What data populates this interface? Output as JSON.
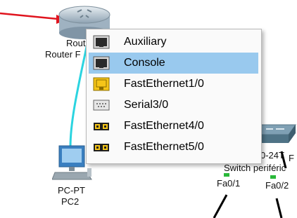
{
  "topology": {
    "router": {
      "label_line1": "Rout",
      "label_line2": "Router F"
    },
    "pc": {
      "model": "PC-PT",
      "name": "PC2"
    },
    "switch": {
      "model": "0-24T",
      "name_fragment": "F",
      "name": "Switch periféric"
    },
    "port_labels": [
      "Fa0/1",
      "Fa0/2"
    ]
  },
  "context_menu": {
    "selected_index": 1,
    "items": [
      {
        "label": "Auxiliary",
        "icon": "aux-port-icon"
      },
      {
        "label": "Console",
        "icon": "console-port-icon"
      },
      {
        "label": "FastEthernet1/0",
        "icon": "fastethernet-port-icon"
      },
      {
        "label": "Serial3/0",
        "icon": "serial-port-icon"
      },
      {
        "label": "FastEthernet4/0",
        "icon": "fastethernet-module-icon"
      },
      {
        "label": "FastEthernet5/0",
        "icon": "fastethernet-module-icon"
      }
    ]
  },
  "colors": {
    "link_console": "#2bd4e0",
    "link_red": "#e0141e",
    "selection": "#99c9ee",
    "port_yellow": "#f5c518"
  }
}
